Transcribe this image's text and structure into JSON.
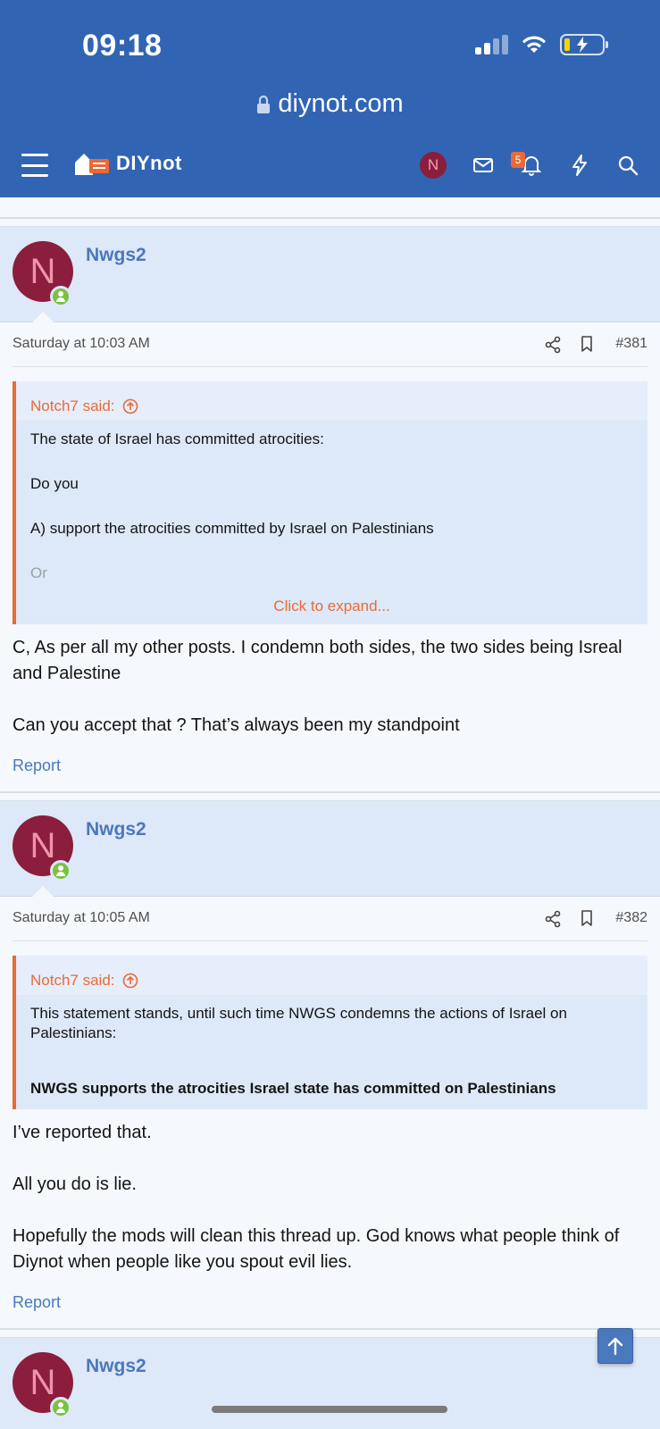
{
  "status_bar": {
    "time": "09:18"
  },
  "browser": {
    "url": "diynot.com"
  },
  "nav": {
    "logo_text": "DIYnot",
    "avatar_initial": "N",
    "notification_count": "5"
  },
  "posts": [
    {
      "username": "Nwgs2",
      "avatar_initial": "N",
      "date": "Saturday at 10:03 AM",
      "number": "#381",
      "quote": {
        "author": "Notch7 said:",
        "lines": [
          "The state of Israel has committed atrocities:",
          "Do you",
          "A) support the atrocities committed by Israel on Palestinians",
          "Or"
        ],
        "expand_label": "Click to expand..."
      },
      "message": [
        "C, As per all my other posts. I condemn both sides, the two sides being Isreal and Palestine",
        "Can you accept that ? That’s always been my standpoint"
      ],
      "report_label": "Report"
    },
    {
      "username": "Nwgs2",
      "avatar_initial": "N",
      "date": "Saturday at 10:05 AM",
      "number": "#382",
      "quote": {
        "author": "Notch7 said:",
        "lines": [
          "This statement stands, until such time NWGS condemns the actions of Israel on Palestinians:",
          "NWGS supports the atrocities Israel state has committed on Palestinians"
        ]
      },
      "message": [
        "I’ve reported that.",
        "All you do is lie.",
        "Hopefully the mods will clean this thread up. God knows what people think of Diynot when people like you spout evil lies."
      ],
      "report_label": "Report"
    },
    {
      "username": "Nwgs2",
      "avatar_initial": "N"
    }
  ]
}
